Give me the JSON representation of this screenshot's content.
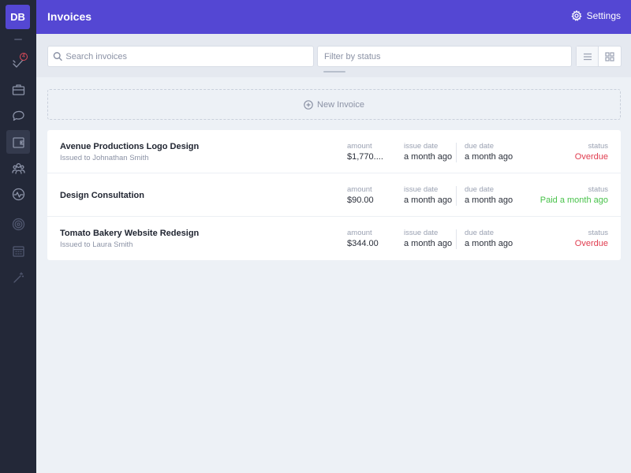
{
  "app": {
    "logo_text": "DB"
  },
  "sidebar": {
    "items": [
      {
        "name": "checkmark",
        "badge": "4"
      },
      {
        "name": "briefcase"
      },
      {
        "name": "chat"
      },
      {
        "name": "wallet",
        "active": true
      },
      {
        "name": "team"
      },
      {
        "name": "activity"
      },
      {
        "name": "target"
      },
      {
        "name": "calendar"
      },
      {
        "name": "magic-wand"
      }
    ]
  },
  "header": {
    "title": "Invoices",
    "settings_label": "Settings"
  },
  "toolbar": {
    "search_placeholder": "Search invoices",
    "filter_placeholder": "Filter by status"
  },
  "new_invoice_label": "New Invoice",
  "columns": {
    "amount": "amount",
    "issue_date": "issue date",
    "due_date": "due date",
    "status": "status"
  },
  "invoices": [
    {
      "title": "Avenue Productions Logo Design",
      "subtitle": "Issued to Johnathan Smith",
      "amount": "$1,770....",
      "issue_date": "a month ago",
      "due_date": "a month ago",
      "status": "Overdue",
      "status_color": "#e03c4f"
    },
    {
      "title": "Design Consultation",
      "subtitle": "",
      "amount": "$90.00",
      "issue_date": "a month ago",
      "due_date": "a month ago",
      "status": "Paid a month ago",
      "status_color": "#48c24a"
    },
    {
      "title": "Tomato Bakery Website Redesign",
      "subtitle": "Issued to Laura Smith",
      "amount": "$344.00",
      "issue_date": "a month ago",
      "due_date": "a month ago",
      "status": "Overdue",
      "status_color": "#e03c4f"
    }
  ],
  "colors": {
    "accent": "#5447d3",
    "sidebar": "#232838",
    "overdue": "#e03c4f",
    "paid": "#48c24a"
  }
}
